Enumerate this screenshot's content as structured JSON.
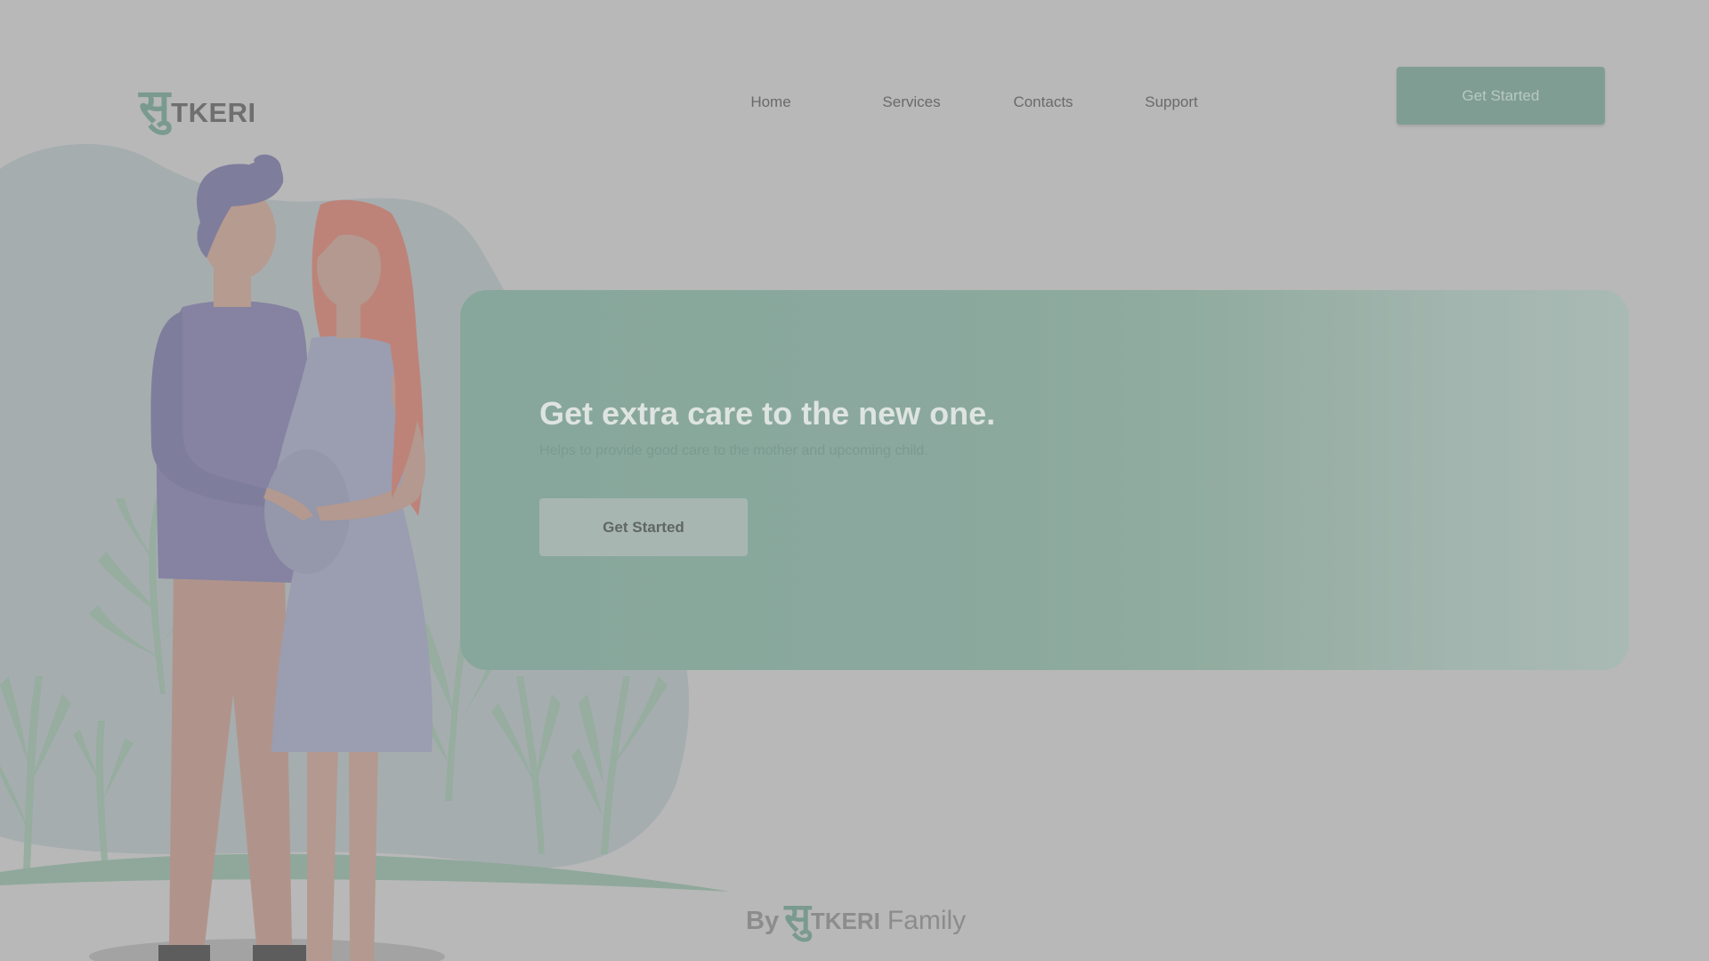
{
  "brand": {
    "logo_glyph": "सु",
    "logo_text": "TKERI"
  },
  "nav": {
    "home": "Home",
    "services": "Services",
    "contacts": "Contacts",
    "support": "Support",
    "cta_label": "Get Started"
  },
  "hero": {
    "title": "Get extra care to the new one.",
    "subtitle": "Helps to provide good care to the mother and upcoming child.",
    "button_label": "Get Started"
  },
  "footer": {
    "by": "By",
    "brand_glyph": "सु",
    "brand_text": "TKERI",
    "suffix": "Family"
  },
  "illustration": {
    "icon": "pregnant-couple-illustration"
  },
  "colors": {
    "background": "#b8b8b8",
    "accent_green": "#7f9d93",
    "hero_gradient_start": "#88a79c",
    "hero_gradient_end": "#a9bab4"
  }
}
